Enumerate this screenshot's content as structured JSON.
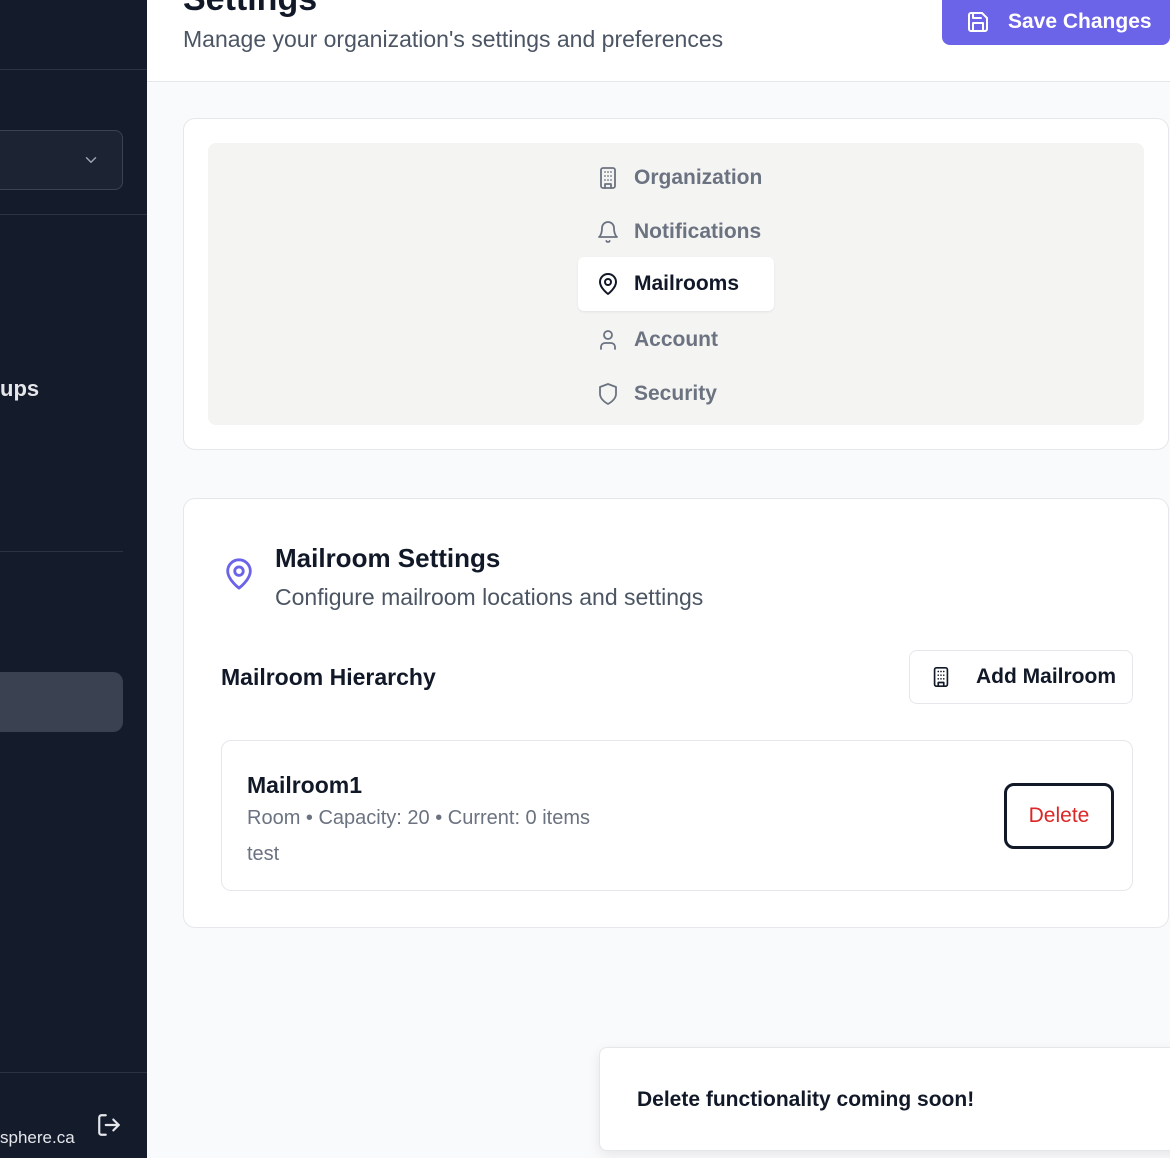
{
  "sidebar": {
    "group_label": "ups",
    "user_email": "sphere.ca",
    "icons": {
      "select_chevron": "chevron-down-icon",
      "logout": "logout-icon"
    }
  },
  "header": {
    "title": "Settings",
    "subtitle": "Manage your organization's settings and preferences",
    "save_label": "Save Changes",
    "save_icon": "save-icon",
    "accent_color": "#6b63e8"
  },
  "tabs": [
    {
      "label": "Organization",
      "icon": "building-icon",
      "active": false
    },
    {
      "label": "Notifications",
      "icon": "bell-icon",
      "active": false
    },
    {
      "label": "Mailrooms",
      "icon": "map-pin-icon",
      "active": true
    },
    {
      "label": "Account",
      "icon": "user-icon",
      "active": false
    },
    {
      "label": "Security",
      "icon": "shield-icon",
      "active": false
    }
  ],
  "mailroom_settings": {
    "title": "Mailroom Settings",
    "description": "Configure mailroom locations and settings",
    "hierarchy_label": "Mailroom Hierarchy",
    "add_label": "Add Mailroom",
    "items": [
      {
        "name": "Mailroom1",
        "meta": "Room • Capacity: 20 • Current: 0 items",
        "note": "test",
        "delete_label": "Delete"
      }
    ]
  },
  "toast": {
    "message": "Delete functionality coming soon!"
  }
}
